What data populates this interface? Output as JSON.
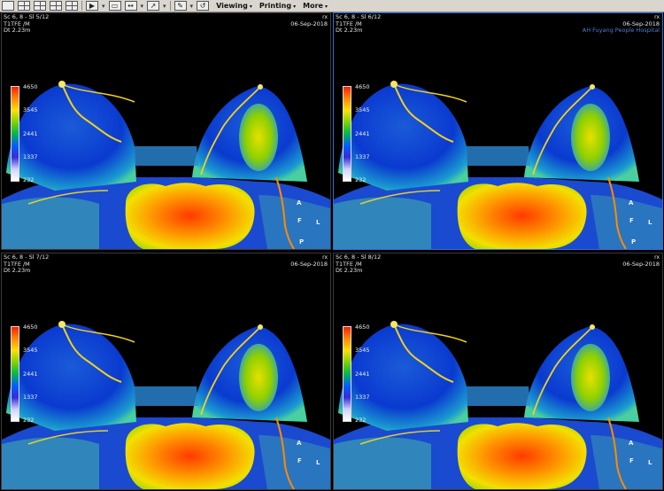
{
  "toolbar": {
    "menus": [
      {
        "label": "Viewing"
      },
      {
        "label": "Printing"
      },
      {
        "label": "More"
      }
    ]
  },
  "viewports": [
    {
      "series": "Sc 6, 8 - Sl 5/12",
      "sequence": "T1TFE    /M",
      "dt": "Dt  2.23m",
      "date": "06-Sep-2018",
      "rx": "rx",
      "hospital": "",
      "colorbar": {
        "ticks": [
          "4650",
          "3545",
          "2441",
          "1337",
          "232"
        ]
      },
      "orient": {
        "A": "A",
        "F": "F",
        "L": "L",
        "P": "P"
      }
    },
    {
      "series": "Sc 6, 8 - Sl 6/12",
      "sequence": "T1TFE    /M",
      "dt": "Dt  2.23m",
      "date": "06-Sep-2018",
      "rx": "rx",
      "hospital": "AH Fuyang People Hospital",
      "colorbar": {
        "ticks": [
          "4650",
          "3545",
          "2441",
          "1337",
          "232"
        ]
      },
      "orient": {
        "A": "A",
        "F": "F",
        "L": "L",
        "P": "P"
      }
    },
    {
      "series": "Sc 6, 8 - Sl 7/12",
      "sequence": "T1TFE    /M",
      "dt": "Dt  2.23m",
      "date": "06-Sep-2018",
      "rx": "rx",
      "hospital": "",
      "colorbar": {
        "ticks": [
          "4650",
          "3545",
          "2441",
          "1337",
          "232"
        ]
      },
      "orient": {
        "A": "A",
        "F": "F",
        "L": "L",
        "P": ""
      }
    },
    {
      "series": "Sc 6, 8 - Sl 8/12",
      "sequence": "T1TFE    /M",
      "dt": "Dt  2.23m",
      "date": "06-Sep-2018",
      "rx": "rx",
      "hospital": "",
      "colorbar": {
        "ticks": [
          "4650",
          "3545",
          "2441",
          "1337",
          "232"
        ]
      },
      "orient": {
        "A": "A",
        "F": "F",
        "L": "L",
        "P": ""
      }
    }
  ],
  "colors": {
    "toolbar_bg": "#d9d6cf",
    "active_border": "#2f6fd0",
    "hospital_text": "#4a7fd8"
  },
  "icons": [
    "layout-1x1-icon",
    "layout-1x2-icon",
    "layout-2x1-icon",
    "layout-2x2-icon",
    "grid-icon",
    "play-icon",
    "cine-icon",
    "measure-icon",
    "pointer-icon",
    "annotate-icon",
    "reset-icon"
  ]
}
